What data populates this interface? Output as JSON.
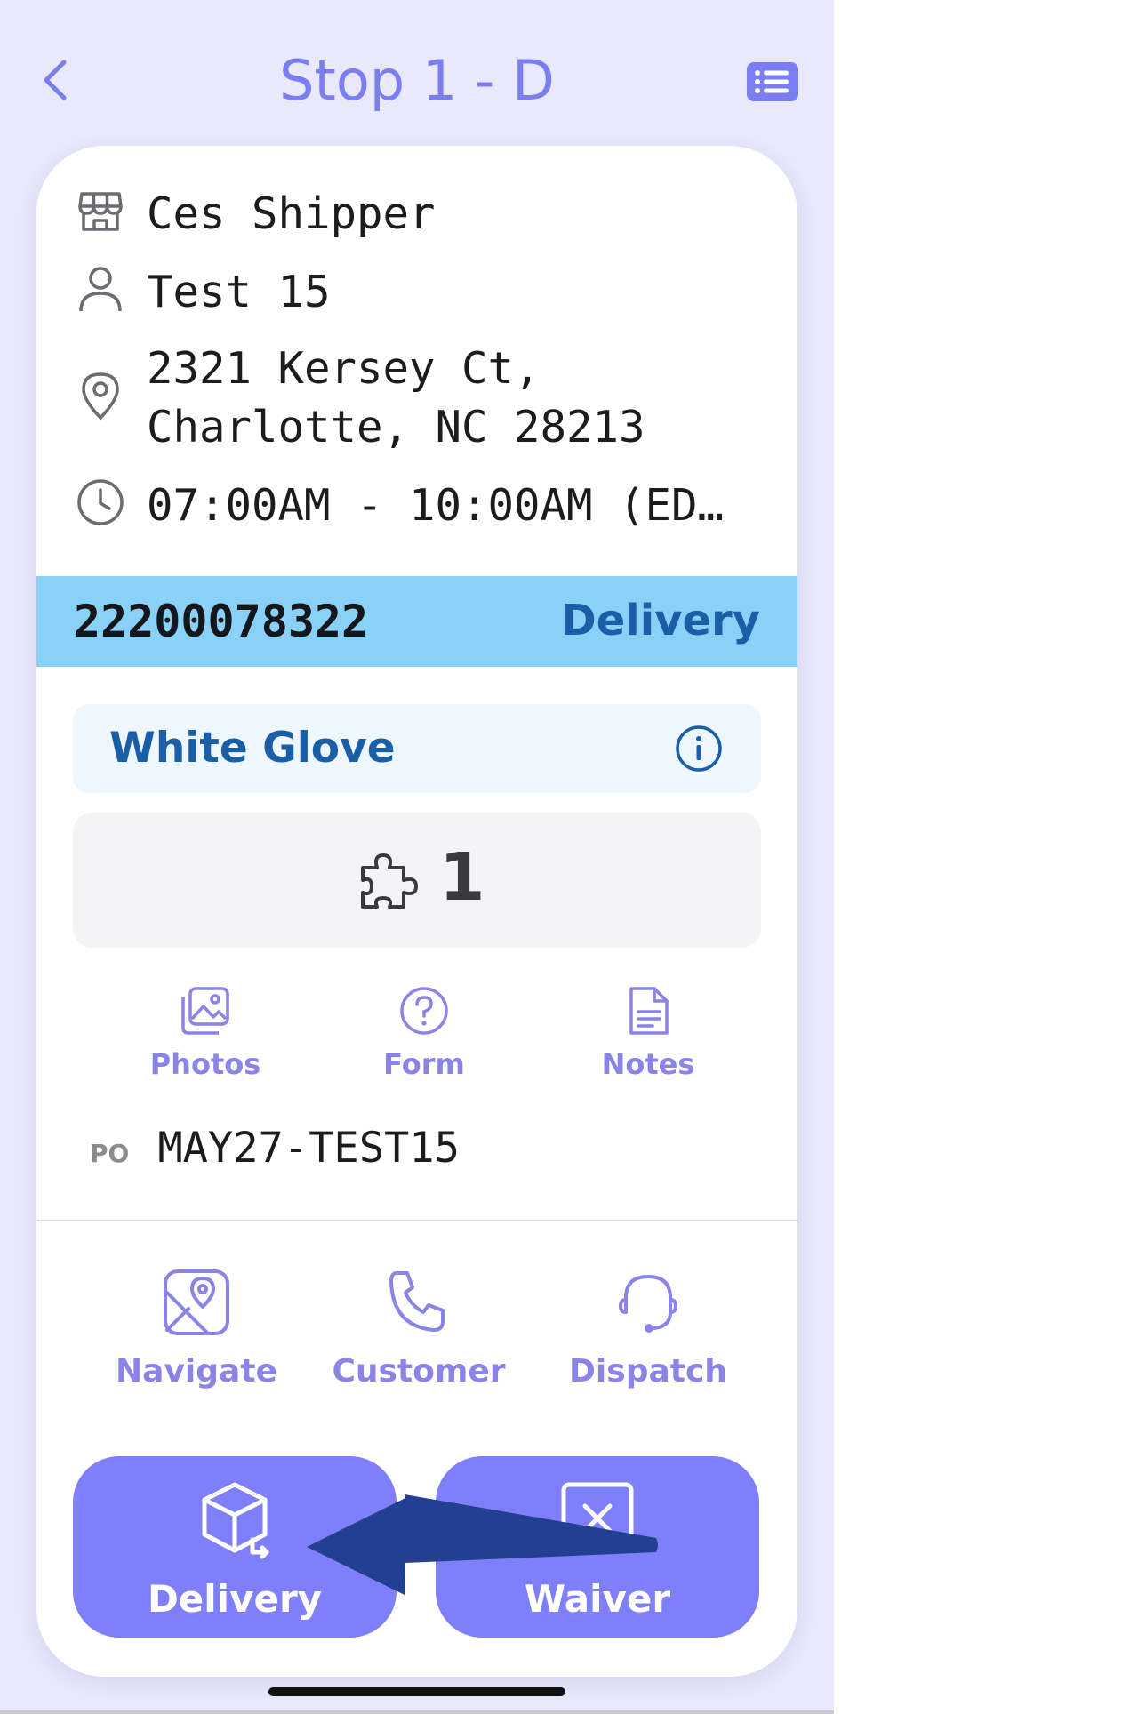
{
  "header": {
    "title": "Stop 1 - D",
    "back_icon": "chevron-left-icon",
    "list_icon": "list-icon"
  },
  "stop": {
    "shipper": "Ces Shipper",
    "contact": "Test 15",
    "address_line1": "2321 Kersey Ct,",
    "address_line2": "Charlotte, NC 28213",
    "time_window": "07:00AM - 10:00AM (ED…"
  },
  "order": {
    "number": "22200078322",
    "type": "Delivery"
  },
  "service": {
    "label": "White Glove"
  },
  "pieces": {
    "count": "1"
  },
  "attachments": [
    {
      "label": "Photos",
      "icon": "photos-icon"
    },
    {
      "label": "Form",
      "icon": "question-icon"
    },
    {
      "label": "Notes",
      "icon": "notes-icon"
    }
  ],
  "po": {
    "label": "PO",
    "value": "MAY27-TEST15"
  },
  "contacts": [
    {
      "label": "Navigate",
      "icon": "map-icon"
    },
    {
      "label": "Customer",
      "icon": "phone-icon"
    },
    {
      "label": "Dispatch",
      "icon": "headset-icon"
    }
  ],
  "actions": {
    "delivery_label": "Delivery",
    "waiver_label": "Waiver"
  },
  "colors": {
    "accent": "#7f80f9",
    "title": "#7b7ef1",
    "band": "#89d1f6",
    "link_blue": "#1a5ea8",
    "annotation_arrow": "#233f91"
  }
}
